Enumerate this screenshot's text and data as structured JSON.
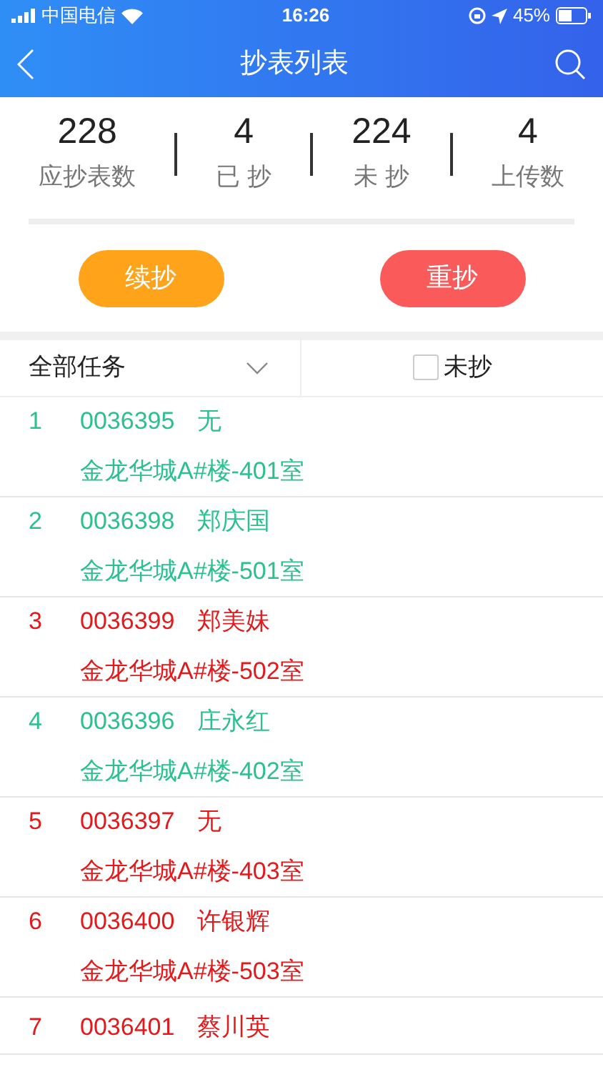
{
  "status_bar": {
    "carrier": "中国电信",
    "time": "16:26",
    "battery": "45%"
  },
  "nav": {
    "title": "抄表列表"
  },
  "stats": [
    {
      "value": "228",
      "label": "应抄表数"
    },
    {
      "value": "4",
      "label": "已 抄"
    },
    {
      "value": "224",
      "label": "未 抄"
    },
    {
      "value": "4",
      "label": "上传数"
    }
  ],
  "buttons": [
    {
      "label": "续抄",
      "color": "#ffa31a"
    },
    {
      "label": "重抄",
      "color": "#fb5a5a"
    }
  ],
  "filter": {
    "task": "全部任务",
    "unread_label": "未抄",
    "unread_checked": false
  },
  "rows": [
    {
      "index": "1",
      "code": "0036395",
      "name": "无",
      "address": "金龙华城A#楼-401室",
      "color": "#2cc08c"
    },
    {
      "index": "2",
      "code": "0036398",
      "name": "郑庆国",
      "address": "金龙华城A#楼-501室",
      "color": "#2cc08c"
    },
    {
      "index": "3",
      "code": "0036399",
      "name": "郑美妹",
      "address": "金龙华城A#楼-502室",
      "color": "#e3191b"
    },
    {
      "index": "4",
      "code": "0036396",
      "name": "庄永红",
      "address": "金龙华城A#楼-402室",
      "color": "#2cc08c"
    },
    {
      "index": "5",
      "code": "0036397",
      "name": "无",
      "address": "金龙华城A#楼-403室",
      "color": "#e3191b"
    },
    {
      "index": "6",
      "code": "0036400",
      "name": "许银辉",
      "address": "金龙华城A#楼-503室",
      "color": "#e3191b"
    },
    {
      "index": "7",
      "code": "0036401",
      "name": "蔡川英",
      "color": "#e3191b"
    }
  ]
}
